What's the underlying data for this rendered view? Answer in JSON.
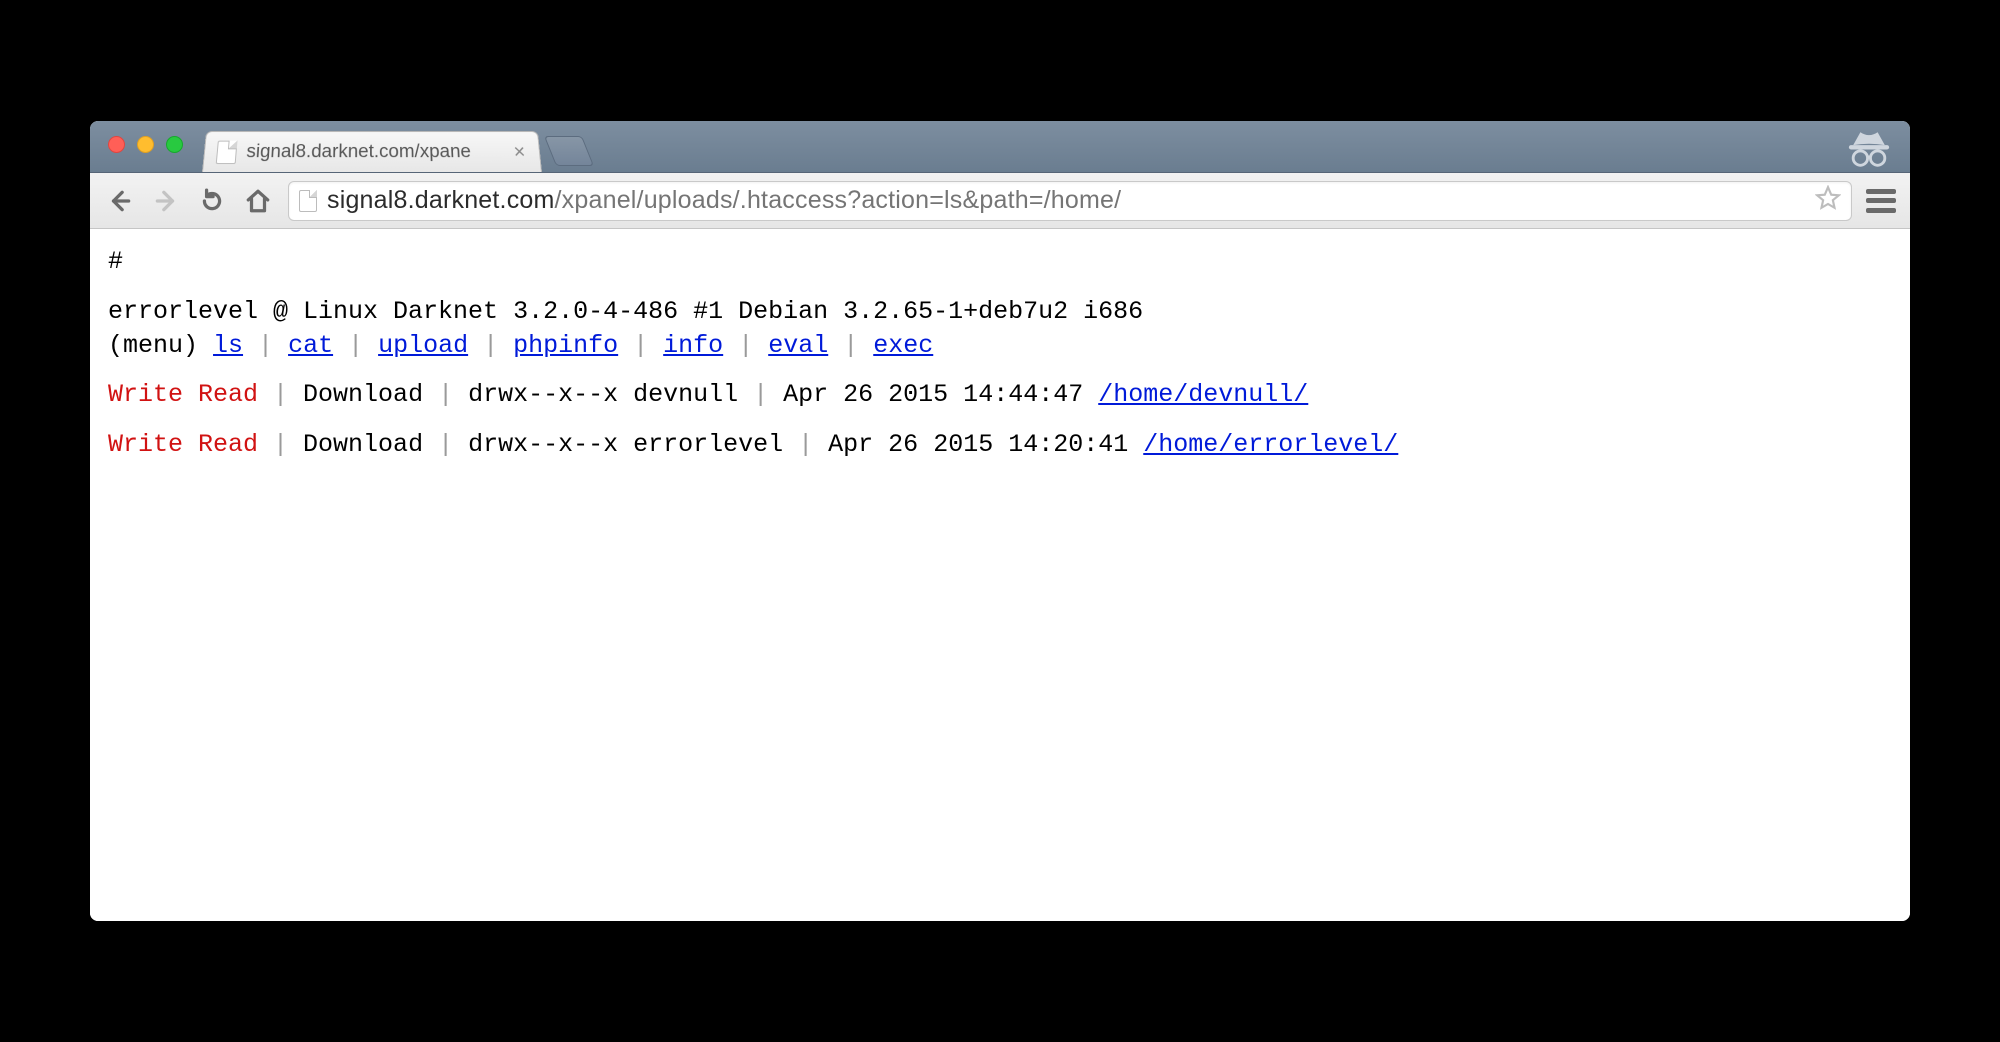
{
  "tab": {
    "title": "signal8.darknet.com/xpane",
    "close_glyph": "×"
  },
  "url": {
    "host": "signal8.darknet.com",
    "path": "/xpanel/uploads/.htaccess?action=ls&path=/home/"
  },
  "page": {
    "shebang": "#",
    "system_line": "errorlevel @ Linux Darknet 3.2.0-4-486 #1 Debian 3.2.65-1+deb7u2 i686",
    "menu_label": "(menu)",
    "menu": {
      "ls": "ls",
      "cat": "cat",
      "upload": "upload",
      "phpinfo": "phpinfo",
      "info": "info",
      "eval": "eval",
      "exec": "exec"
    },
    "pipe": " | ",
    "entries": [
      {
        "perm_text": "Write Read",
        "download": "Download",
        "mode_owner": "drwx--x--x devnull",
        "mtime": "Apr 26 2015 14:44:47",
        "path": "/home/devnull/"
      },
      {
        "perm_text": "Write Read",
        "download": "Download",
        "mode_owner": "drwx--x--x errorlevel",
        "mtime": "Apr 26 2015 14:20:41",
        "path": "/home/errorlevel/"
      }
    ]
  }
}
